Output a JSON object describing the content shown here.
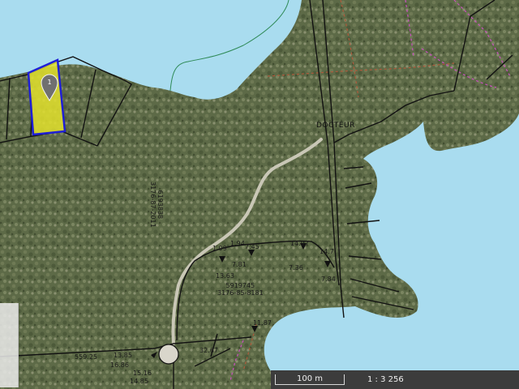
{
  "map": {
    "selected_parcel": {
      "marker_number": "1"
    },
    "place_label": "DOCTEUR",
    "lot_labels": {
      "north": "6193838\n3176-87-2011",
      "central": "5919745\n3176-85-8181"
    },
    "segment_dims": [
      "1.99",
      "1.94",
      "7.45",
      "7.81",
      "14.97",
      "7.36",
      "14.7",
      "7.84",
      "13.63",
      "11.87"
    ],
    "bottom_dims": [
      "559.25",
      "13.85",
      "16.86",
      "15.16",
      "14.85",
      "32.67"
    ],
    "scale": {
      "distance": "100 m",
      "ratio": "1 : 3 256"
    },
    "colors": {
      "water": "#a9dcef",
      "forest": "#5d6a47",
      "parcel_fill": "#e3e22d",
      "parcel_border": "#1f1fd6",
      "lot_lines": "#111111",
      "cadastre_brown": "#b05a3c",
      "cadastre_magenta": "#c94fbf"
    }
  }
}
